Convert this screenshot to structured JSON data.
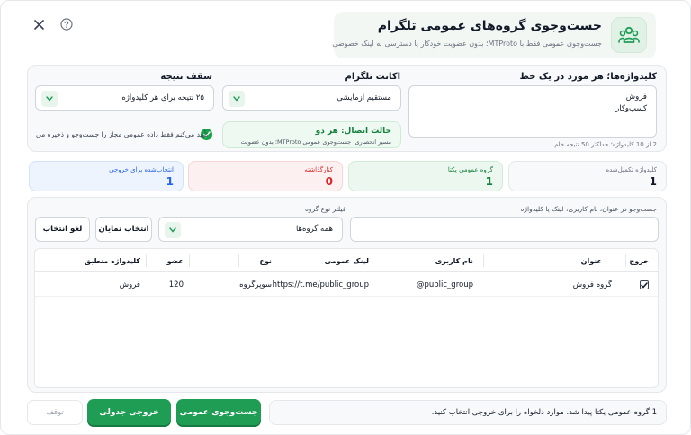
{
  "header": {
    "title": "جست‌وجوی گروه‌های عمومی تلگرام",
    "subtitle": "جست‌وجوی عمومی فقط با MTProto؛ بدون عضویت خودکار یا دسترسی به لینک خصوصی"
  },
  "config": {
    "keywords_label": "کلیدواژه‌ها؛ هر مورد در یک خط",
    "keywords_value": "فروش\nکسب‌وکار",
    "keywords_hint": "2 از 10 کلیدواژه؛ حداکثر 50 نتیجه خام",
    "account_label": "اکانت تلگرام",
    "account_value": "مستقیم آزمایشی",
    "limit_label": "سقف نتیجه",
    "limit_value": "۲۵ نتیجه برای هر کلیدواژه",
    "status_title": "حالت اتصال: هر دو",
    "status_sub": "مسیر انحصاری: جست‌وجوی عمومی MTProto؛ بدون عضویت",
    "confirm_text": "تأیید می‌کنم فقط داده عمومی مجاز را جست‌وجو و ذخیره می"
  },
  "stats": [
    {
      "label": "کلیدواژه تکمیل‌شده",
      "value": "1"
    },
    {
      "label": "گروه عمومی یکتا",
      "value": "1"
    },
    {
      "label": "کنارگذاشته",
      "value": "0"
    },
    {
      "label": "انتخاب‌شده برای خروجی",
      "value": "1"
    }
  ],
  "filters": {
    "search_label": "جست‌وجو در عنوان، نام کاربری، لینک یا کلیدواژه",
    "type_label": "فیلتر نوع گروه",
    "type_value": "همه گروه‌ها",
    "select_visible": "انتخاب نمایان",
    "deselect": "لغو انتخاب"
  },
  "table": {
    "headers": {
      "export": "خروج",
      "title": "عنوان",
      "username": "نام کاربری",
      "link": "لینک عمومی",
      "type": "نوع",
      "members": "عضو",
      "keyword": "کلیدواژه منطبق"
    },
    "rows": [
      {
        "checked": true,
        "title": "گروه فروش",
        "username": "@public_group",
        "link": "https://t.me/public_group",
        "type": "سوپرگروه",
        "members": "120",
        "keyword": "فروش"
      }
    ]
  },
  "footer": {
    "message": "1 گروه عمومی یکتا پیدا شد. موارد دلخواه را برای خروجی انتخاب کنید.",
    "search_button": "جست‌وجوی عمومی",
    "export_button": "خروجی جدولی",
    "stop_button": "توقف"
  },
  "colors": {
    "accent": "#1f9d55",
    "stat_green_bg": "#ecf8ef",
    "stat_red_bg": "#fdf0f0",
    "stat_blue_bg": "#eef4fd"
  }
}
